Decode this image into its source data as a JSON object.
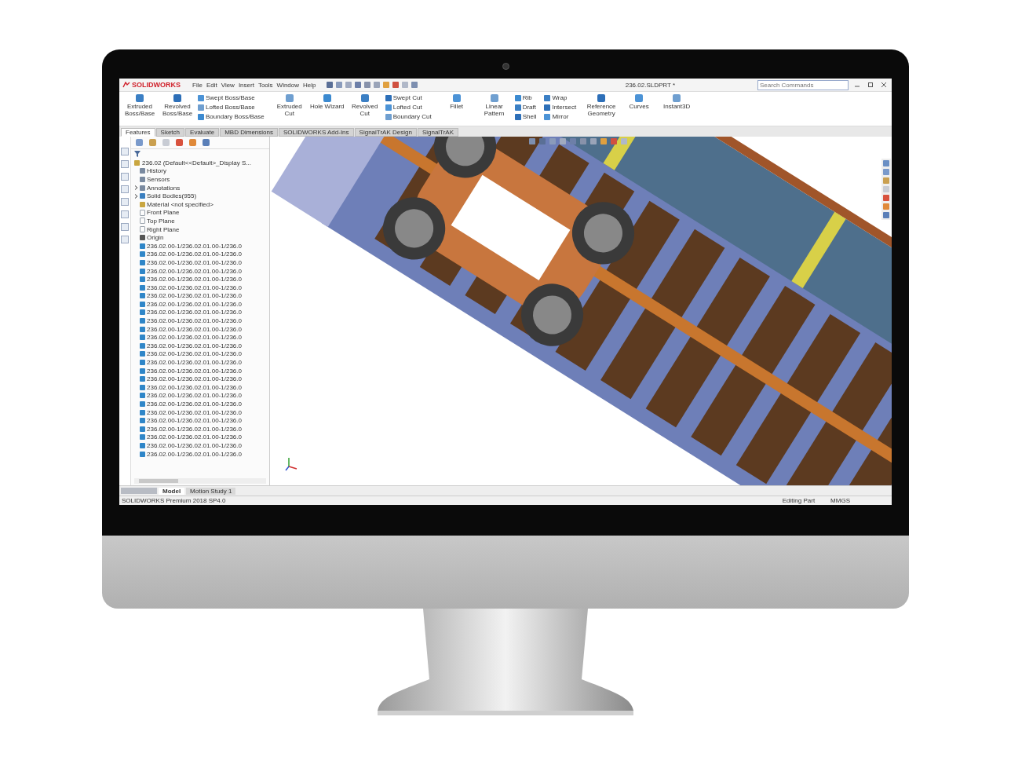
{
  "app": {
    "logo": "SOLIDWORKS",
    "menus": [
      "File",
      "Edit",
      "View",
      "Insert",
      "Tools",
      "Window",
      "Help"
    ],
    "document_title": "236.02.SLDPRT *",
    "search": {
      "placeholder": "Search Commands"
    }
  },
  "ribbon": [
    {
      "kind": "large",
      "label": "Extruded Boss/Base"
    },
    {
      "kind": "large",
      "label": "Revolved Boss/Base"
    },
    {
      "kind": "stack",
      "items": [
        "Swept Boss/Base",
        "Lofted Boss/Base",
        "Boundary Boss/Base"
      ]
    },
    {
      "kind": "large",
      "label": "Extruded Cut"
    },
    {
      "kind": "large",
      "label": "Hole Wizard"
    },
    {
      "kind": "large",
      "label": "Revolved Cut"
    },
    {
      "kind": "stack",
      "items": [
        "Swept Cut",
        "Lofted Cut",
        "Boundary Cut"
      ]
    },
    {
      "kind": "large",
      "label": "Fillet"
    },
    {
      "kind": "large",
      "label": "Linear Pattern"
    },
    {
      "kind": "stack",
      "items": [
        "Rib",
        "Draft",
        "Shell"
      ]
    },
    {
      "kind": "stack",
      "items": [
        "Wrap",
        "Intersect",
        "Mirror"
      ]
    },
    {
      "kind": "large",
      "label": "Reference Geometry"
    },
    {
      "kind": "large",
      "label": "Curves"
    },
    {
      "kind": "large",
      "label": "Instant3D"
    }
  ],
  "tabs": [
    {
      "label": "Features",
      "selected": true
    },
    {
      "label": "Sketch",
      "selected": false
    },
    {
      "label": "Evaluate",
      "selected": false
    },
    {
      "label": "MBD Dimensions",
      "selected": false
    },
    {
      "label": "SOLIDWORKS Add-Ins",
      "selected": false
    },
    {
      "label": "SignalTrAK Design",
      "selected": false
    },
    {
      "label": "SignalTrAK",
      "selected": false
    }
  ],
  "tree": {
    "root": "236.02  (Default<<Default>_Display S...",
    "items": [
      {
        "kind": "folder",
        "label": "History",
        "expandable": false
      },
      {
        "kind": "folder",
        "label": "Sensors",
        "expandable": false
      },
      {
        "kind": "folder",
        "label": "Annotations",
        "expandable": true
      },
      {
        "kind": "bodies",
        "label": "Solid Bodies(955)",
        "expandable": true
      },
      {
        "kind": "material",
        "label": "Material <not specified>",
        "expandable": false
      },
      {
        "kind": "plane",
        "label": "Front Plane",
        "expandable": false
      },
      {
        "kind": "plane",
        "label": "Top Plane",
        "expandable": false
      },
      {
        "kind": "plane",
        "label": "Right Plane",
        "expandable": false
      },
      {
        "kind": "origin",
        "label": "Origin",
        "expandable": false
      },
      {
        "kind": "part",
        "label": "236.02.00-1/236.02.01.00-1/236.0",
        "expandable": false
      },
      {
        "kind": "part",
        "label": "236.02.00-1/236.02.01.00-1/236.0",
        "expandable": false
      },
      {
        "kind": "part",
        "label": "236.02.00-1/236.02.01.00-1/236.0",
        "expandable": false
      },
      {
        "kind": "part",
        "label": "236.02.00-1/236.02.01.00-1/236.0",
        "expandable": false
      },
      {
        "kind": "part",
        "label": "236.02.00-1/236.02.01.00-1/236.0",
        "expandable": false
      },
      {
        "kind": "part",
        "label": "236.02.00-1/236.02.01.00-1/236.0",
        "expandable": false
      },
      {
        "kind": "part",
        "label": "236.02.00-1/236.02.01.00-1/236.0",
        "expandable": false
      },
      {
        "kind": "part",
        "label": "236.02.00-1/236.02.01.00-1/236.0",
        "expandable": false
      },
      {
        "kind": "part",
        "label": "236.02.00-1/236.02.01.00-1/236.0",
        "expandable": false
      },
      {
        "kind": "part",
        "label": "236.02.00-1/236.02.01.00-1/236.0",
        "expandable": false
      },
      {
        "kind": "part",
        "label": "236.02.00-1/236.02.01.00-1/236.0",
        "expandable": false
      },
      {
        "kind": "part",
        "label": "236.02.00-1/236.02.01.00-1/236.0",
        "expandable": false
      },
      {
        "kind": "part",
        "label": "236.02.00-1/236.02.01.00-1/236.0",
        "expandable": false
      },
      {
        "kind": "part",
        "label": "236.02.00-1/236.02.01.00-1/236.0",
        "expandable": false
      },
      {
        "kind": "part",
        "label": "236.02.00-1/236.02.01.00-1/236.0",
        "expandable": false
      },
      {
        "kind": "part",
        "label": "236.02.00-1/236.02.01.00-1/236.0",
        "expandable": false
      },
      {
        "kind": "part",
        "label": "236.02.00-1/236.02.01.00-1/236.0",
        "expandable": false
      },
      {
        "kind": "part",
        "label": "236.02.00-1/236.02.01.00-1/236.0",
        "expandable": false
      },
      {
        "kind": "part",
        "label": "236.02.00-1/236.02.01.00-1/236.0",
        "expandable": false
      },
      {
        "kind": "part",
        "label": "236.02.00-1/236.02.01.00-1/236.0",
        "expandable": false
      },
      {
        "kind": "part",
        "label": "236.02.00-1/236.02.01.00-1/236.0",
        "expandable": false
      },
      {
        "kind": "part",
        "label": "236.02.00-1/236.02.01.00-1/236.0",
        "expandable": false
      },
      {
        "kind": "part",
        "label": "236.02.00-1/236.02.01.00-1/236.0",
        "expandable": false
      },
      {
        "kind": "part",
        "label": "236.02.00-1/236.02.01.00-1/236.0",
        "expandable": false
      },
      {
        "kind": "part",
        "label": "236.02.00-1/236.02.01.00-1/236.0",
        "expandable": false
      },
      {
        "kind": "part",
        "label": "236.02.00-1/236.02.01.00-1/236.0",
        "expandable": false
      }
    ]
  },
  "bottom_tabs": [
    {
      "label": "Model",
      "selected": true
    },
    {
      "label": "Motion Study 1",
      "selected": false
    }
  ],
  "status": {
    "product": "SOLIDWORKS Premium 2018 SP4.0",
    "mode": "Editing Part",
    "units": "MMGS"
  }
}
